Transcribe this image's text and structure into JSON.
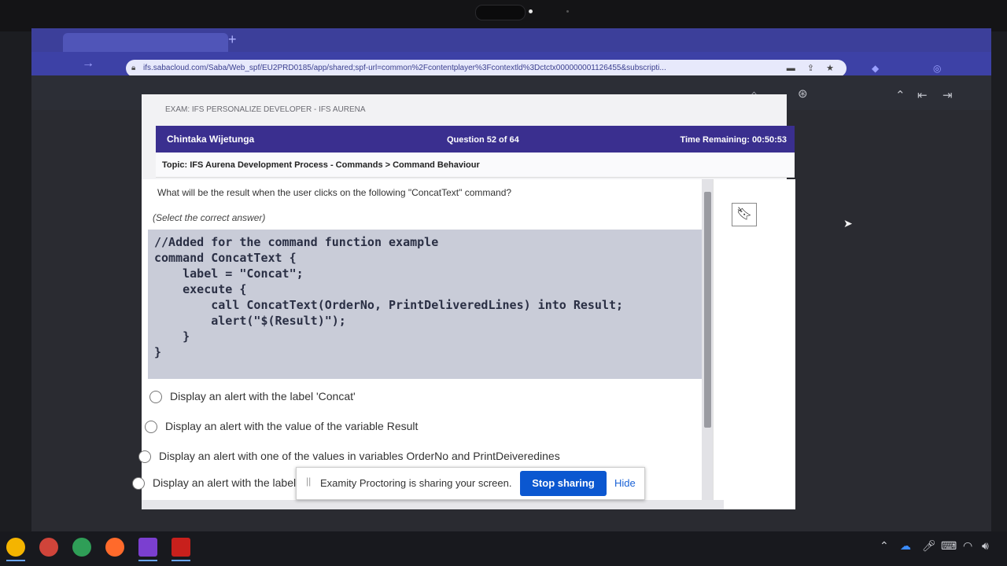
{
  "browser": {
    "url": "ifs.sabacloud.com/Saba/Web_spf/EU2PRD0185/app/shared;spf-url=common%2Fcontentplayer%3Fcontextld%3Dctctx000000001126455&subscripti..."
  },
  "exam": {
    "title": "EXAM: IFS PERSONALIZE DEVELOPER - IFS AURENA",
    "candidate": "Chintaka Wijetunga",
    "question_counter": "Question 52 of 64",
    "time_remaining": "Time Remaining: 00:50:53",
    "topic": "Topic: IFS Aurena Development Process - Commands > Command Behaviour"
  },
  "question": {
    "text": "What will be the result when the user clicks on the following \"ConcatText\" command?",
    "instruction": "(Select the correct answer)",
    "code": "//Added for the command function example\ncommand ConcatText {\n    label = \"Concat\";\n    execute {\n        call ConcatText(OrderNo, PrintDeliveredLines) into Result;\n        alert(\"$(Result)\");\n    }\n}"
  },
  "options": [
    "Display an alert with the label 'Concat'",
    "Display an alert with the value of the variable Result",
    "Display an alert with one of the values in variables OrderNo and PrintDeiveredines",
    "Display an alert with the label 'R..."
  ],
  "share_bar": {
    "message": "Examity Proctoring is sharing your screen.",
    "stop_label": "Stop sharing",
    "hide_label": "Hide"
  },
  "icons": {
    "bookmark": "bookmark-icon",
    "lock": "lock-icon",
    "cursor": "mouse-cursor-icon"
  },
  "colors": {
    "header_bg": "#3a2f8f",
    "chrome_bg": "#3d41a6",
    "stop_button": "#0b57d0"
  }
}
